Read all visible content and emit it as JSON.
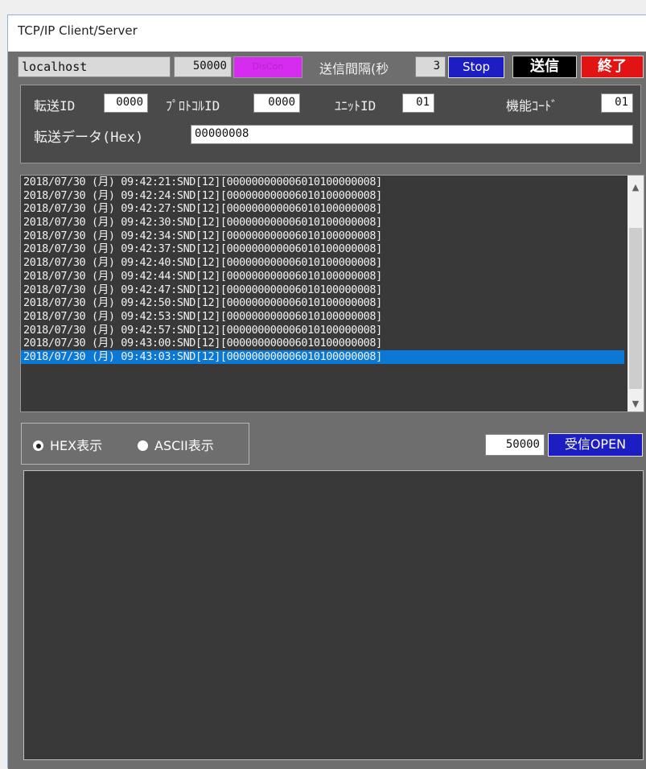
{
  "window": {
    "title": "TCP/IP Client/Server"
  },
  "toolbar": {
    "host": "localhost",
    "port": "50000",
    "disconnect_label": "DisCon",
    "interval_label": "送信間隔(秒",
    "interval_value": "3",
    "stop_label": "Stop",
    "send_label": "送信",
    "exit_label": "終了"
  },
  "modbus": {
    "transfer_id_label": "転送ID",
    "transfer_id": "0000",
    "protocol_id_label": "ﾌﾟﾛﾄｺﾙID",
    "protocol_id": "0000",
    "unit_id_label": "ﾕﾆｯﾄID",
    "unit_id": "01",
    "function_code_label": "機能ｺｰﾄﾞ",
    "function_code": "01",
    "data_label": "転送データ(Hex)",
    "data_value": "00000008"
  },
  "log": {
    "lines": [
      "2018/07/30 (月) 09:42:21:SND[12][000000000006010100000008]",
      "2018/07/30 (月) 09:42:24:SND[12][000000000006010100000008]",
      "2018/07/30 (月) 09:42:27:SND[12][000000000006010100000008]",
      "2018/07/30 (月) 09:42:30:SND[12][000000000006010100000008]",
      "2018/07/30 (月) 09:42:34:SND[12][000000000006010100000008]",
      "2018/07/30 (月) 09:42:37:SND[12][000000000006010100000008]",
      "2018/07/30 (月) 09:42:40:SND[12][000000000006010100000008]",
      "2018/07/30 (月) 09:42:44:SND[12][000000000006010100000008]",
      "2018/07/30 (月) 09:42:47:SND[12][000000000006010100000008]",
      "2018/07/30 (月) 09:42:50:SND[12][000000000006010100000008]",
      "2018/07/30 (月) 09:42:53:SND[12][000000000006010100000008]",
      "2018/07/30 (月) 09:42:57:SND[12][000000000006010100000008]",
      "2018/07/30 (月) 09:43:00:SND[12][000000000006010100000008]",
      "2018/07/30 (月) 09:43:03:SND[12][000000000006010100000008]"
    ],
    "selected_index": 13
  },
  "display_mode": {
    "hex_label": "HEX表示",
    "ascii_label": "ASCII表示",
    "selected": "hex"
  },
  "receive": {
    "port": "50000",
    "open_label": "受信OPEN",
    "content": ""
  },
  "colors": {
    "disconnect": "#d52cf0",
    "stop": "#1c1ec4",
    "send": "#000000",
    "exit": "#e11313",
    "selection": "#0a78d4"
  }
}
